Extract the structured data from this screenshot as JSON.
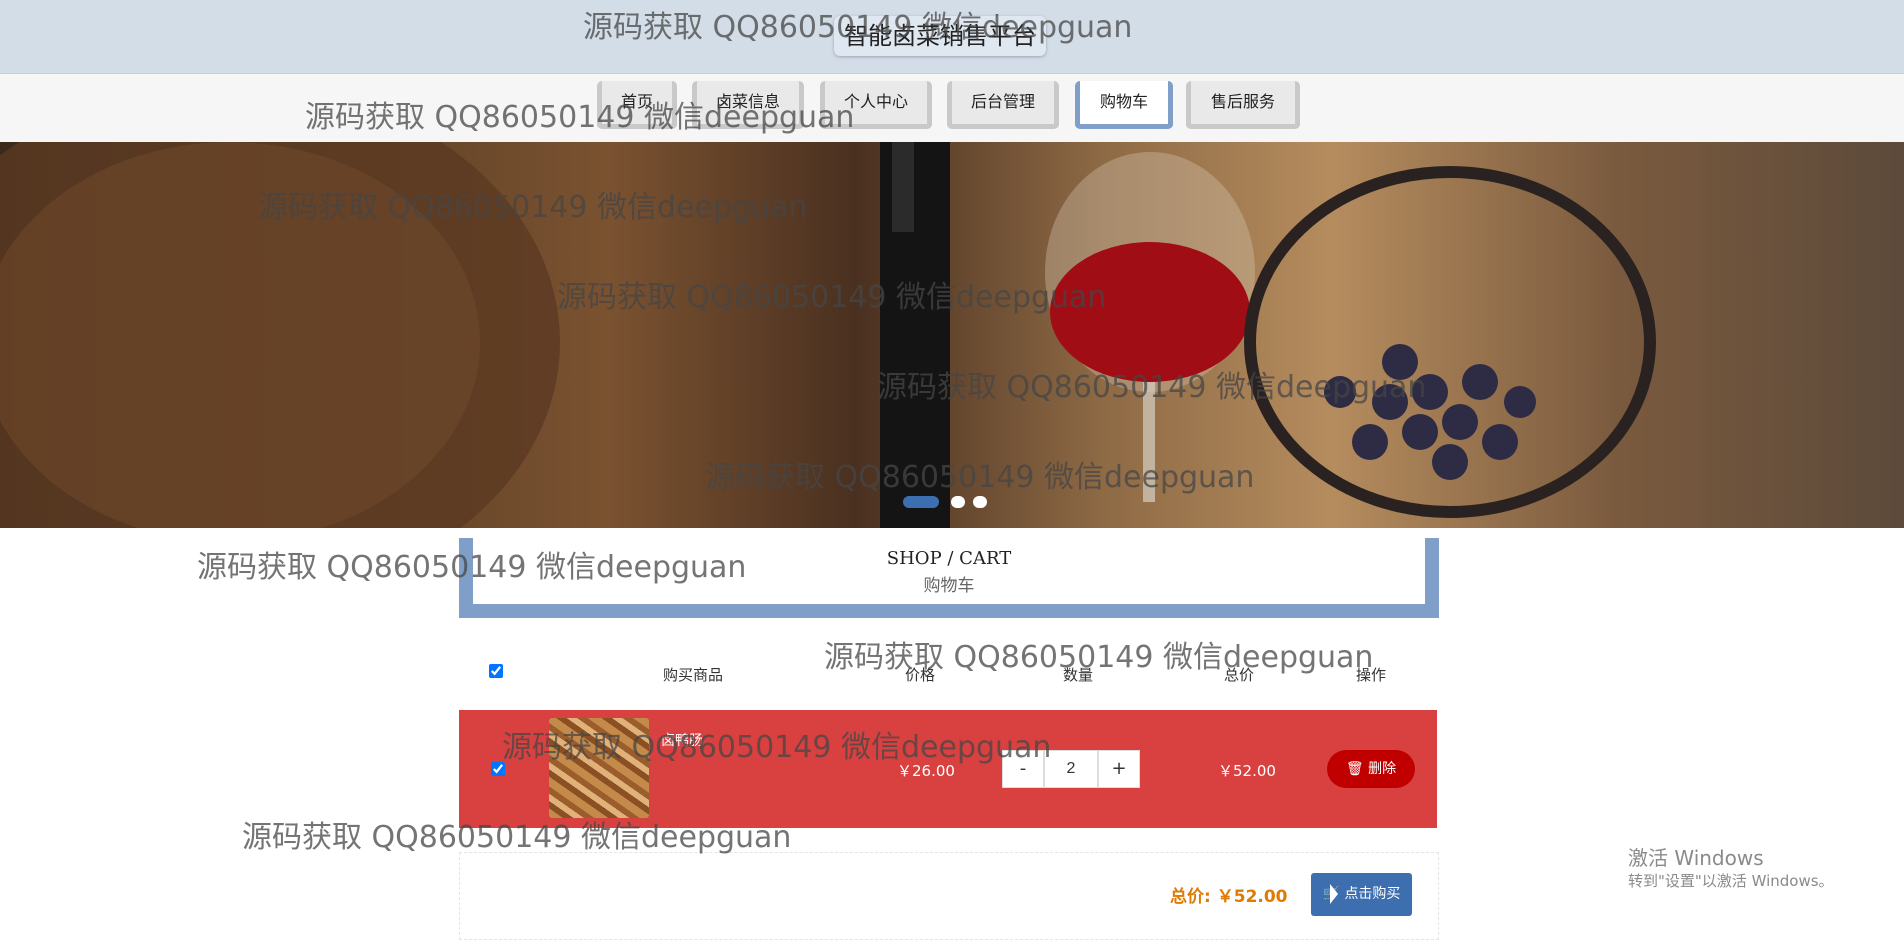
{
  "header": {
    "site_title": "智能卤菜销售平台"
  },
  "nav": {
    "items": [
      {
        "label": "首页"
      },
      {
        "label": "卤菜信息"
      },
      {
        "label": "个人中心"
      },
      {
        "label": "后台管理"
      },
      {
        "label": "购物车",
        "active": true
      },
      {
        "label": "售后服务"
      }
    ]
  },
  "banner": {
    "slide_count": 3,
    "active_slide": 1
  },
  "section": {
    "title_en": "SHOP / CART",
    "title_cn": "购物车"
  },
  "cart": {
    "headers": {
      "product": "购买商品",
      "price": "价格",
      "quantity": "数量",
      "total": "总价",
      "action": "操作"
    },
    "items": [
      {
        "name": "卤鸭肠",
        "price": "￥26.00",
        "quantity": "2",
        "total": "￥52.00",
        "delete_label": "删除",
        "minus": "-",
        "plus": "+"
      }
    ],
    "total_label": "总价:",
    "total_value": "￥52.00",
    "buy_label": "点击购买"
  },
  "watermark": "源码获取 QQ86050149 微信deepguan",
  "windows_activation": {
    "line1": "激活 Windows",
    "line2": "转到\"设置\"以激活 Windows。"
  },
  "colors": {
    "accent": "#7f9fc8",
    "row_highlight": "#d94040",
    "delete": "#c00000",
    "buy": "#3d6fb0",
    "total": "#e07a00"
  }
}
